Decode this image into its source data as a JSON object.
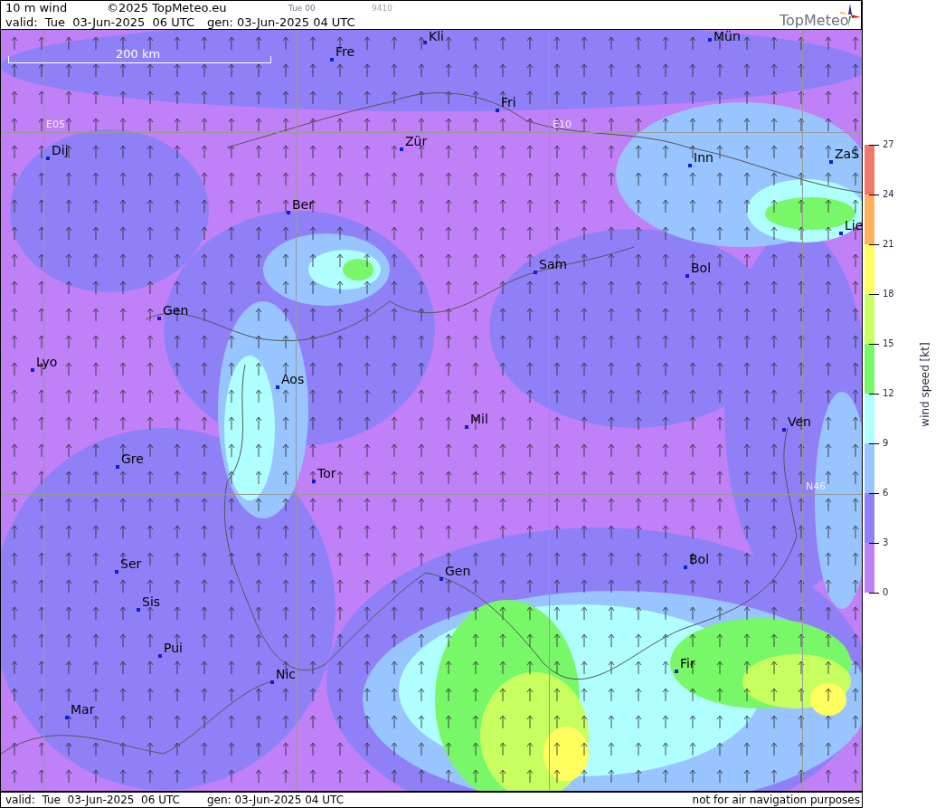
{
  "header": {
    "title": "10 m wind",
    "copyright": "©2025 TopMeteo.eu",
    "run": "Tue 00",
    "code": "9410",
    "valid": "valid:  Tue  03-Jun-2025  06 UTC",
    "generated": "gen: 03-Jun-2025 04 UTC",
    "logo": "TopMeteo"
  },
  "map": {
    "scale_label": "200 km",
    "grid_labels": [
      "E05",
      "E10",
      "N46"
    ],
    "cities": [
      {
        "name": "Kli"
      },
      {
        "name": "Mün"
      },
      {
        "name": "Fre"
      },
      {
        "name": "Fri"
      },
      {
        "name": "Dij"
      },
      {
        "name": "Zür"
      },
      {
        "name": "Inn"
      },
      {
        "name": "ZaS"
      },
      {
        "name": "Ber"
      },
      {
        "name": "Lie"
      },
      {
        "name": "Sam"
      },
      {
        "name": "Bol"
      },
      {
        "name": "Gen"
      },
      {
        "name": "Lyo"
      },
      {
        "name": "Aos"
      },
      {
        "name": "Mil"
      },
      {
        "name": "Ven"
      },
      {
        "name": "Gre"
      },
      {
        "name": "Tor"
      },
      {
        "name": "Ser"
      },
      {
        "name": "Gen"
      },
      {
        "name": "Bol"
      },
      {
        "name": "Sis"
      },
      {
        "name": "Pui"
      },
      {
        "name": "Fir"
      },
      {
        "name": "Nic"
      },
      {
        "name": "Mar"
      }
    ]
  },
  "legend": {
    "title": "wind speed [kt]",
    "ticks": [
      "27",
      "24",
      "21",
      "18",
      "15",
      "12",
      "9",
      "6",
      "3",
      "0"
    ],
    "bins": [
      {
        "color": "#f07868"
      },
      {
        "color": "#ffb060"
      },
      {
        "color": "#ffff60"
      },
      {
        "color": "#c8ff60"
      },
      {
        "color": "#78f868"
      },
      {
        "color": "#b0ffff"
      },
      {
        "color": "#98c4ff"
      },
      {
        "color": "#9080f8"
      },
      {
        "color": "#c080f8"
      }
    ]
  },
  "footer": {
    "valid": "valid:  Tue  03-Jun-2025  06 UTC",
    "generated": "gen: 03-Jun-2025 04 UTC",
    "note": "not for air navigation purposes"
  }
}
